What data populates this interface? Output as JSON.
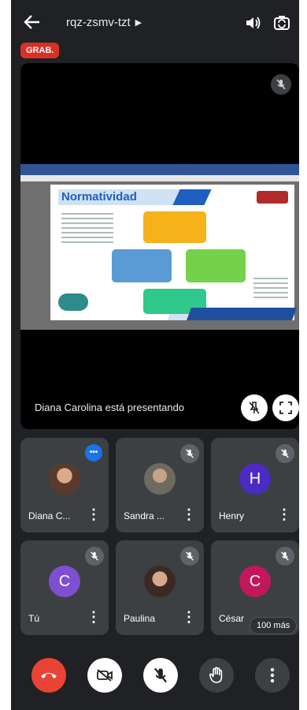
{
  "header": {
    "meeting_code": "rqz-zsmv-tzt",
    "recording_badge": "GRAB."
  },
  "stage": {
    "presenting_text": "Diana Carolina está presentando",
    "slide_title": "Normatividad"
  },
  "participants": [
    {
      "name": "Diana C...",
      "avatar": "photo",
      "speaking": true
    },
    {
      "name": "Sandra ...",
      "avatar": "photo",
      "muted": true
    },
    {
      "name": "Henry",
      "avatar_letter": "H",
      "avatar_color": "#4b2bc2",
      "muted": true
    },
    {
      "name": "Tú",
      "avatar_letter": "C",
      "avatar_color": "#7e4fd1",
      "muted": true
    },
    {
      "name": "Paulina",
      "avatar": "photo",
      "muted": true
    },
    {
      "name": "César",
      "avatar_letter": "C",
      "avatar_color": "#c2185b",
      "muted": true
    }
  ],
  "more_participants": "100 más",
  "colors": {
    "background": "#202124",
    "tile": "#3c4043",
    "end_call": "#ea4335",
    "recording": "#d93025"
  },
  "icons": [
    "back-arrow-icon",
    "chevron-right-icon",
    "speaker-icon",
    "switch-camera-icon",
    "mic-off-icon",
    "fullscreen-icon",
    "pin-off-icon",
    "end-call-icon",
    "camera-off-icon",
    "raise-hand-icon",
    "more-vert-icon"
  ]
}
